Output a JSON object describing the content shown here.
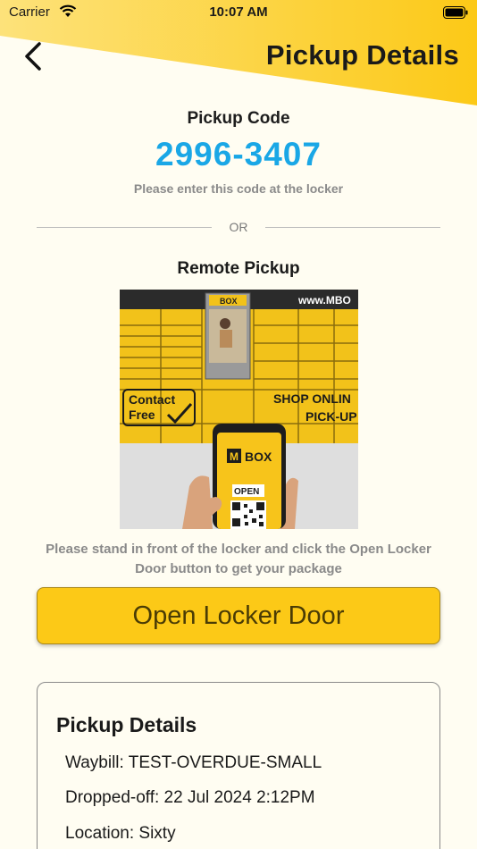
{
  "status_bar": {
    "carrier": "Carrier",
    "time": "10:07 AM"
  },
  "header": {
    "title": "Pickup Details",
    "back_icon": "chevron-left-icon"
  },
  "pickup_code": {
    "label": "Pickup Code",
    "code": "2996-3407",
    "hint": "Please enter this code at the locker"
  },
  "divider": {
    "label": "OR"
  },
  "remote": {
    "label": "Remote Pickup",
    "image_text": {
      "brand": "BOX",
      "website": "www.MBO",
      "contact_line1": "Contact",
      "contact_line2": "Free",
      "shop_line1": "SHOP ONLIN",
      "shop_line2": "PICK-UP",
      "phone_brand": "BOX",
      "phone_open": "OPEN"
    },
    "instructions": "Please stand in front of the locker and click the Open Locker Door button to get your package",
    "button_label": "Open Locker Door"
  },
  "details": {
    "title": "Pickup Details",
    "waybill": "Waybill: TEST-OVERDUE-SMALL",
    "dropped_off": "Dropped-off: 22 Jul 2024 2:12PM",
    "location": "Location: Sixty"
  },
  "colors": {
    "accent_yellow": "#fcc917",
    "code_blue": "#1aa7e6",
    "background": "#fffdf2"
  }
}
